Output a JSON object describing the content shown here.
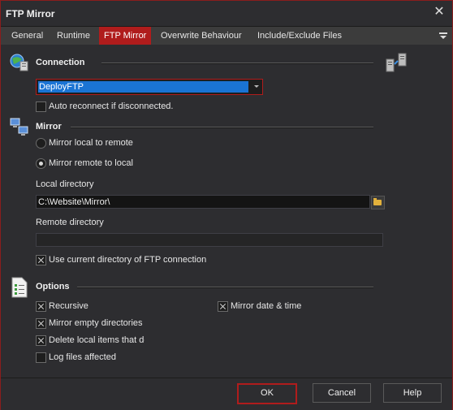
{
  "window": {
    "title": "FTP Mirror"
  },
  "tabs": [
    {
      "label": "General"
    },
    {
      "label": "Runtime"
    },
    {
      "label": "FTP Mirror",
      "active": true
    },
    {
      "label": "Overwrite Behaviour"
    },
    {
      "label": "Include/Exclude Files"
    }
  ],
  "connection": {
    "heading": "Connection",
    "selected": "DeployFTP",
    "auto_reconnect_label": "Auto reconnect if disconnected.",
    "auto_reconnect_checked": false
  },
  "mirror": {
    "heading": "Mirror",
    "local_to_remote_label": "Mirror local to remote",
    "remote_to_local_label": "Mirror remote to local",
    "selected_direction": "remote_to_local",
    "local_dir_label": "Local directory",
    "local_dir_value": "C:\\Website\\Mirror\\",
    "remote_dir_label": "Remote directory",
    "remote_dir_value": "",
    "use_current_dir_label": "Use current directory of FTP connection",
    "use_current_dir_checked": true
  },
  "options": {
    "heading": "Options",
    "recursive_label": "Recursive",
    "recursive_checked": true,
    "mirror_empty_label": "Mirror empty directories",
    "mirror_empty_checked": true,
    "delete_local_label": "Delete local items that dc",
    "delete_local_checked": true,
    "log_files_label": "Log files affected",
    "log_files_checked": false,
    "mirror_date_label": "Mirror date & time",
    "mirror_date_checked": true
  },
  "buttons": {
    "ok": "OK",
    "cancel": "Cancel",
    "help": "Help"
  },
  "colors": {
    "accent": "#b01c1c",
    "selection": "#1a74d4",
    "background": "#2d2d30"
  }
}
